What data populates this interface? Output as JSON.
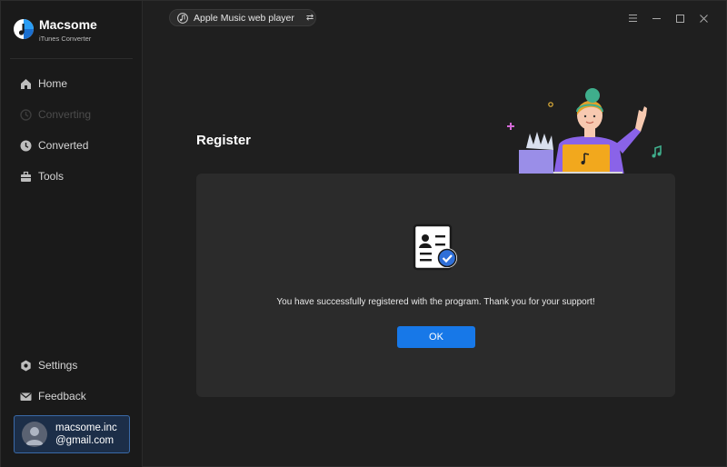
{
  "app": {
    "brand_name": "Macsome",
    "brand_subtitle": "iTunes Converter"
  },
  "sidebar": {
    "items": [
      {
        "label": "Home",
        "icon": "home-icon",
        "enabled": true
      },
      {
        "label": "Converting",
        "icon": "converting-icon",
        "enabled": false
      },
      {
        "label": "Converted",
        "icon": "clock-icon",
        "enabled": true
      },
      {
        "label": "Tools",
        "icon": "toolbox-icon",
        "enabled": true
      }
    ],
    "bottom_items": [
      {
        "label": "Settings",
        "icon": "gear-icon"
      },
      {
        "label": "Feedback",
        "icon": "mail-icon"
      }
    ],
    "account": {
      "email_line1": "macsome.inc",
      "email_line2": "@gmail.com"
    }
  },
  "topbar": {
    "source_label": "Apple Music web player",
    "switch_icon": "switch-icon",
    "window_controls": [
      "menu-icon",
      "minimize-icon",
      "maximize-icon",
      "close-icon"
    ]
  },
  "main": {
    "title": "Register",
    "message": "You have successfully registered with the program. Thank you for your support!",
    "ok_label": "OK"
  },
  "colors": {
    "accent": "#1778e8",
    "background": "#1f1f1f",
    "card": "#2b2b2b",
    "account_bg": "#1c2e48"
  }
}
